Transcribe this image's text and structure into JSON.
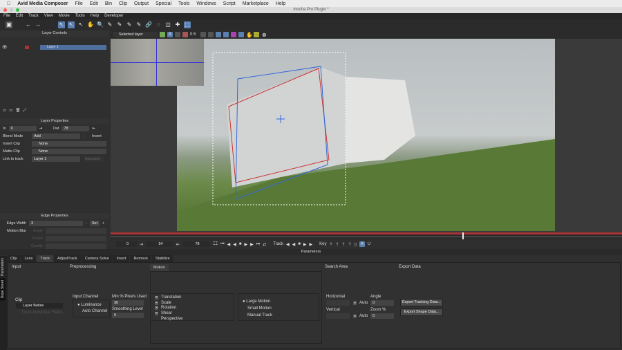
{
  "os_menu": {
    "app": "Avid Media Composer",
    "items": [
      "File",
      "Edit",
      "Bin",
      "Clip",
      "Output",
      "Special",
      "Tools",
      "Windows",
      "Script",
      "Marketplace",
      "Help"
    ]
  },
  "window_title": "mocha Pro Plugin *",
  "app_menu": [
    "File",
    "Edit",
    "Track",
    "View",
    "Movie",
    "Tools",
    "Help",
    "Developer"
  ],
  "layer_controls": {
    "title": "Layer Controls",
    "layers": [
      {
        "name": "Layer 1"
      }
    ]
  },
  "layer_properties": {
    "title": "Layer Properties",
    "in_label": "In",
    "in": "0",
    "out_label": "Out",
    "out": "78",
    "blend_label": "Blend Mode",
    "blend": "Add",
    "invert": "Invert",
    "insert_label": "Insert Clip",
    "insert": "None",
    "matte_label": "Matte Clip",
    "matte": "None",
    "link_label": "Link to track",
    "link": "Layer 1",
    "adjusted": "Adjusted"
  },
  "edge_properties": {
    "title": "Edge Properties",
    "width_label": "Edge Width",
    "width": "3",
    "set": "Set",
    "motion_blur": "Motion Blur",
    "angle": "Angle",
    "phase": "Phase",
    "quality": "Quality"
  },
  "viewer": {
    "layer_select": "Selected layer",
    "opacity": "0.5"
  },
  "transport": {
    "start": "0",
    "current": "54",
    "end": "78",
    "track_label": "Track",
    "key_label": "Key",
    "timeline_position": 0.69
  },
  "parameters": {
    "title": "Parameters",
    "tabs": [
      "Clip",
      "Lens",
      "Track",
      "AdjustTrack",
      "Camera Solve",
      "Insert",
      "Remove",
      "Stabilize"
    ],
    "active_tab": "Track",
    "side_tabs": [
      "Parameters",
      "Dope Sheet"
    ],
    "input": {
      "title": "Input",
      "clip_label": "Clip",
      "clip": "Layer Below",
      "track_individual": "Track Individual Fields"
    },
    "preprocessing": {
      "title": "Preprocessing",
      "channel_label": "Input Channel",
      "channels": [
        "Luminance",
        "Auto Channel"
      ],
      "min_pixels_label": "Min % Pixels Used",
      "min_pixels": "30",
      "smoothing_label": "Smoothing Level",
      "smoothing": "0"
    },
    "motion": {
      "title": "Motion",
      "types": [
        {
          "label": "Translation",
          "checked": true
        },
        {
          "label": "Scale",
          "checked": true
        },
        {
          "label": "Rotation",
          "checked": true
        },
        {
          "label": "Shear",
          "checked": true
        },
        {
          "label": "Perspective",
          "checked": false
        }
      ],
      "modes": [
        "Large Motion",
        "Small Motion",
        "Manual Track"
      ]
    },
    "search_area": {
      "title": "Search Area",
      "horizontal": "Horizontal",
      "vertical": "Vertical",
      "auto": "Auto",
      "angle_label": "Angle",
      "angle": "0",
      "zoom_label": "Zoom %",
      "zoom": "0"
    },
    "export": {
      "title": "Export Data",
      "tracking": "Export Tracking Data...",
      "shape": "Export Shape Data..."
    }
  }
}
